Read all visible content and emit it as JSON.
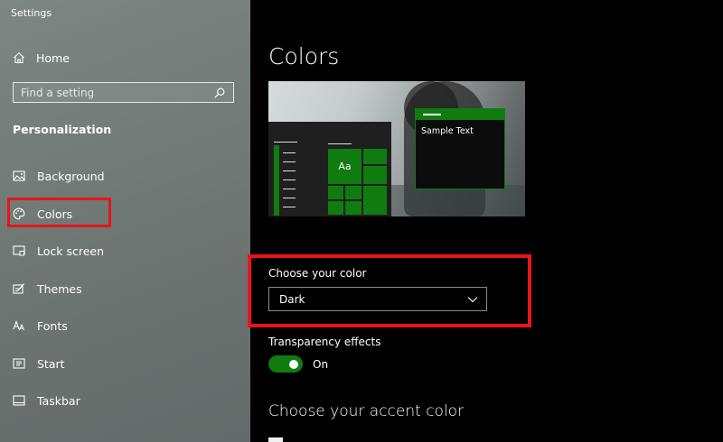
{
  "window": {
    "title": "Settings"
  },
  "sidebar": {
    "home_label": "Home",
    "search": {
      "placeholder": "Find a setting"
    },
    "section_label": "Personalization",
    "items": [
      {
        "label": "Background",
        "icon": "picture-icon"
      },
      {
        "label": "Colors",
        "icon": "palette-icon",
        "selected": true
      },
      {
        "label": "Lock screen",
        "icon": "lock-screen-icon"
      },
      {
        "label": "Themes",
        "icon": "themes-icon"
      },
      {
        "label": "Fonts",
        "icon": "fonts-icon"
      },
      {
        "label": "Start",
        "icon": "start-icon"
      },
      {
        "label": "Taskbar",
        "icon": "taskbar-icon"
      }
    ]
  },
  "main": {
    "title": "Colors",
    "preview": {
      "tile_label": "Aa",
      "sample_text": "Sample Text"
    },
    "choose_color": {
      "label": "Choose your color",
      "value": "Dark"
    },
    "transparency": {
      "label": "Transparency effects",
      "state": "On",
      "enabled": true
    },
    "accent_title": "Choose your accent color"
  },
  "colors": {
    "accent": "#107c10",
    "highlight": "#e8151b",
    "background": "#000000"
  }
}
